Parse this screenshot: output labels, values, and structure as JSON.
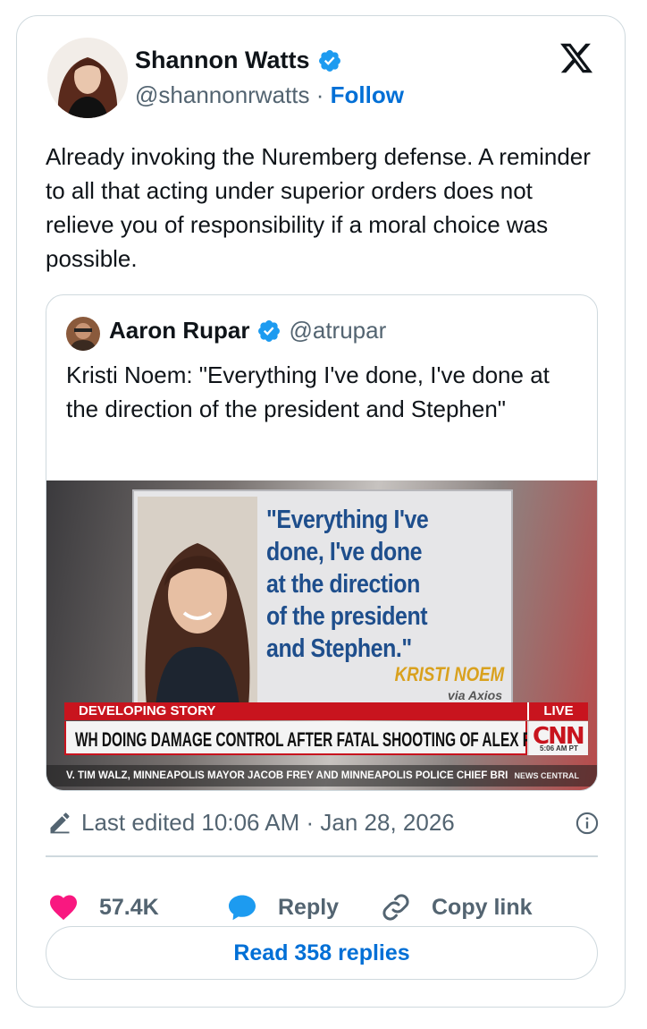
{
  "author": {
    "name": "Shannon Watts",
    "handle": "@shannonrwatts",
    "separator": "·",
    "follow_label": "Follow"
  },
  "tweet": {
    "text": "Already invoking the Nuremberg defense. A reminder to all that acting under superior orders does not relieve you of responsibility if a moral choice was possible."
  },
  "quoted_tweet": {
    "name": "Aaron Rupar",
    "handle": "@atrupar",
    "text": "Kristi Noem: \"Everything I've done, I've done at the direction of the president and Stephen\"",
    "media": {
      "quote_lines": [
        "\"Everything I've",
        "done, I've done",
        "at the direction",
        "of the president",
        "and Stephen.\""
      ],
      "quote_attribution": "KRISTI NOEM",
      "quote_source": "via Axios",
      "banner_label": "DEVELOPING STORY",
      "live_label": "LIVE",
      "headline": "WH DOING DAMAGE CONTROL AFTER FATAL SHOOTING OF ALEX PRETTI",
      "network_logo": "CNN",
      "time": "5:06 AM PT",
      "ticker": "V. TIM WALZ, MINNEAPOLIS MAYOR JACOB FREY AND MINNEAPOLIS POLICE CHIEF BRI",
      "ticker_tag": "NEWS CENTRAL"
    }
  },
  "meta": {
    "edited_text": "Last edited 10:06 AM · Jan 28, 2026"
  },
  "actions": {
    "likes": "57.4K",
    "reply_label": "Reply",
    "copy_link_label": "Copy link"
  },
  "read_replies_label": "Read 358 replies",
  "colors": {
    "accent": "#006fd6",
    "verified": "#1d9bf0",
    "like": "#f91880",
    "muted": "#536471",
    "border": "#cfd9de"
  },
  "icons": [
    "verified-badge-icon",
    "x-logo-icon",
    "edit-pencil-icon",
    "info-icon",
    "heart-icon",
    "reply-bubble-icon",
    "link-icon"
  ]
}
